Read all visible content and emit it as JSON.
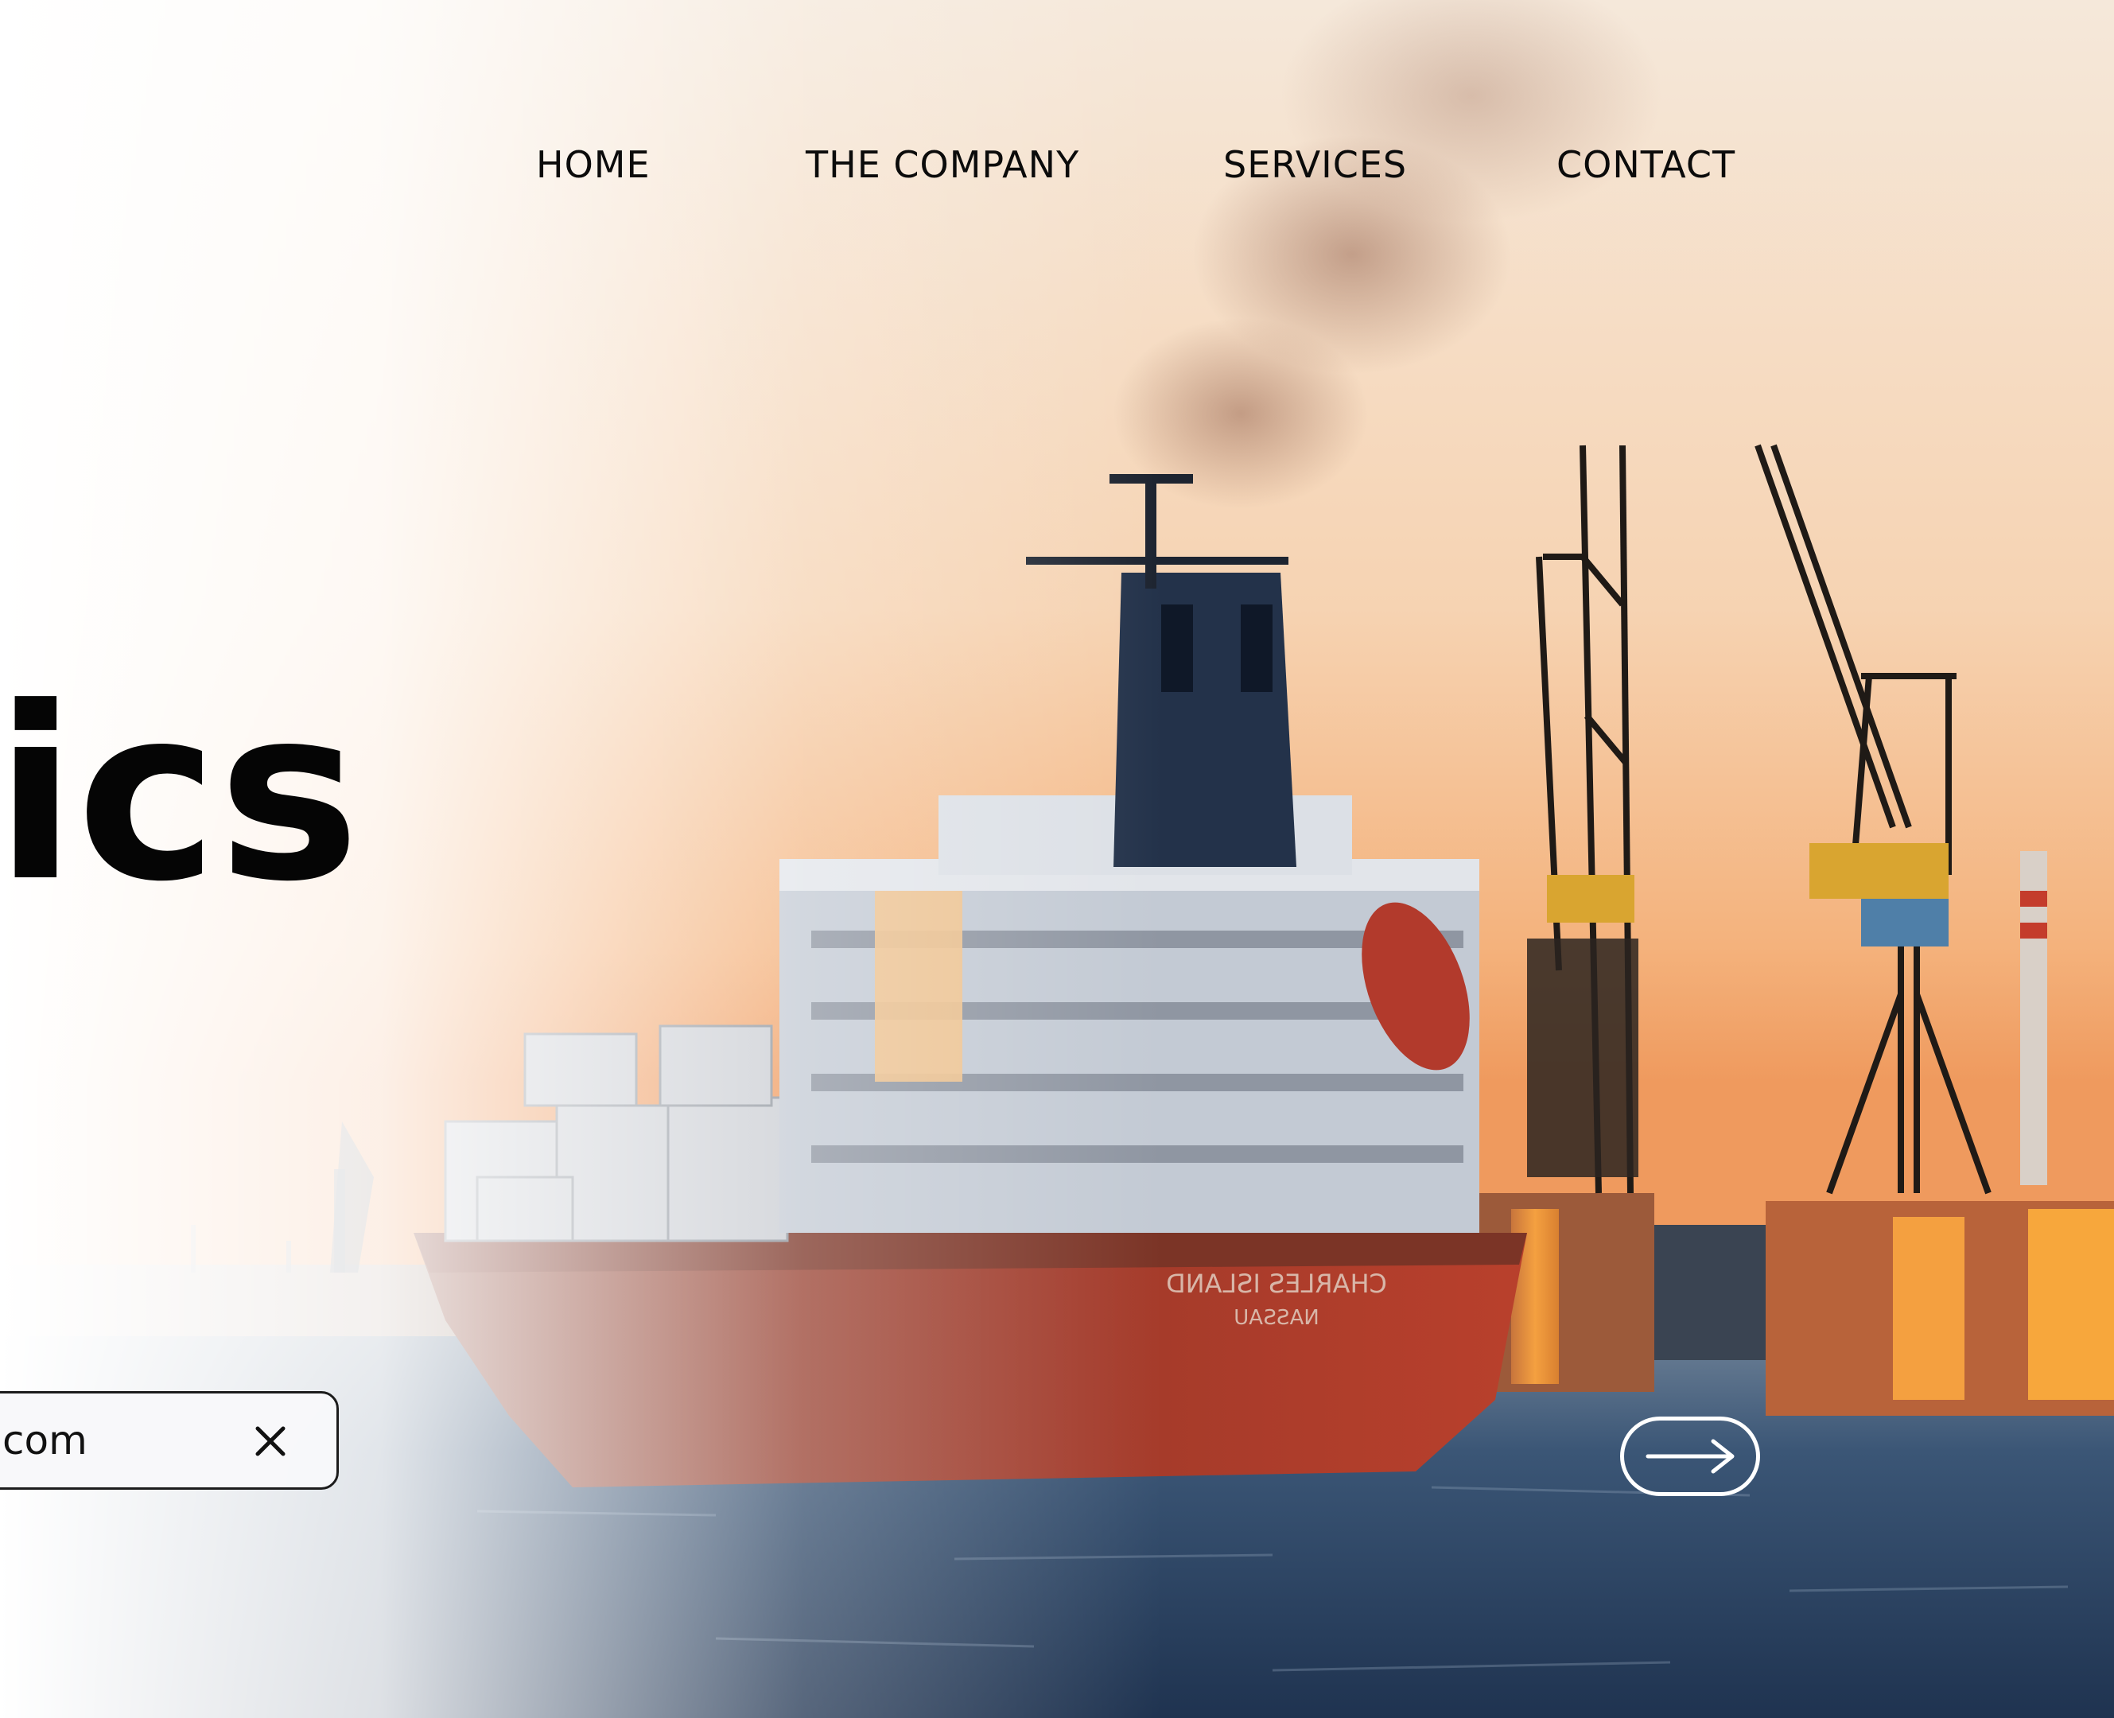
{
  "nav": {
    "items": [
      {
        "label": "HOME"
      },
      {
        "label": "THE COMPANY"
      },
      {
        "label": "SERVICES"
      },
      {
        "label": "CONTACT"
      }
    ]
  },
  "hero": {
    "headline_fragment": "tics",
    "ship_name": "CHARLES ISLAND",
    "ship_port": "NASSAU"
  },
  "signup": {
    "email_value": "com",
    "clear_icon": "close-icon"
  },
  "cta": {
    "icon": "arrow-right-icon",
    "border_color": "#ffffff"
  },
  "colors": {
    "sky_top": "#f3e3d3",
    "sky_horizon": "#f2a86a",
    "water": "#2f4a68",
    "hull": "#b9402c",
    "text": "#0b0b0b"
  }
}
